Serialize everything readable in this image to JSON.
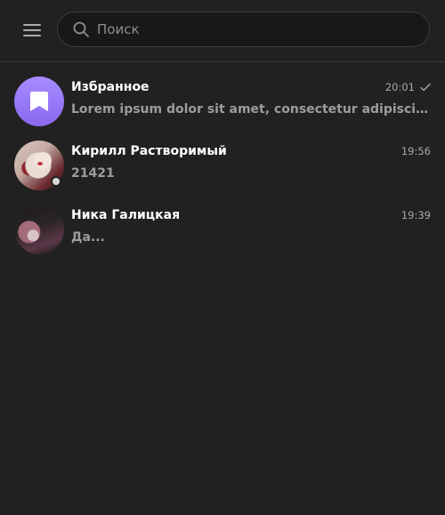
{
  "header": {
    "menu_icon": "hamburger-menu-icon",
    "search_placeholder": "Поиск",
    "search_value": ""
  },
  "chats": [
    {
      "name": "Избранное",
      "time": "20:01",
      "preview": "Lorem ipsum dolor sit amet, consectetur adipiscing elit",
      "read_status": "sent-check",
      "avatar": "bookmark-icon",
      "avatar_color": "#9b7cf7"
    },
    {
      "name": "Кирилл Растворимый",
      "time": "19:56",
      "preview": "21421",
      "online": true
    },
    {
      "name": "Ника Галицкая",
      "time": "19:39",
      "preview": "Да..."
    }
  ],
  "colors": {
    "background": "#212121",
    "search_bg": "#181818",
    "secondary_text": "#9c9c9c"
  }
}
